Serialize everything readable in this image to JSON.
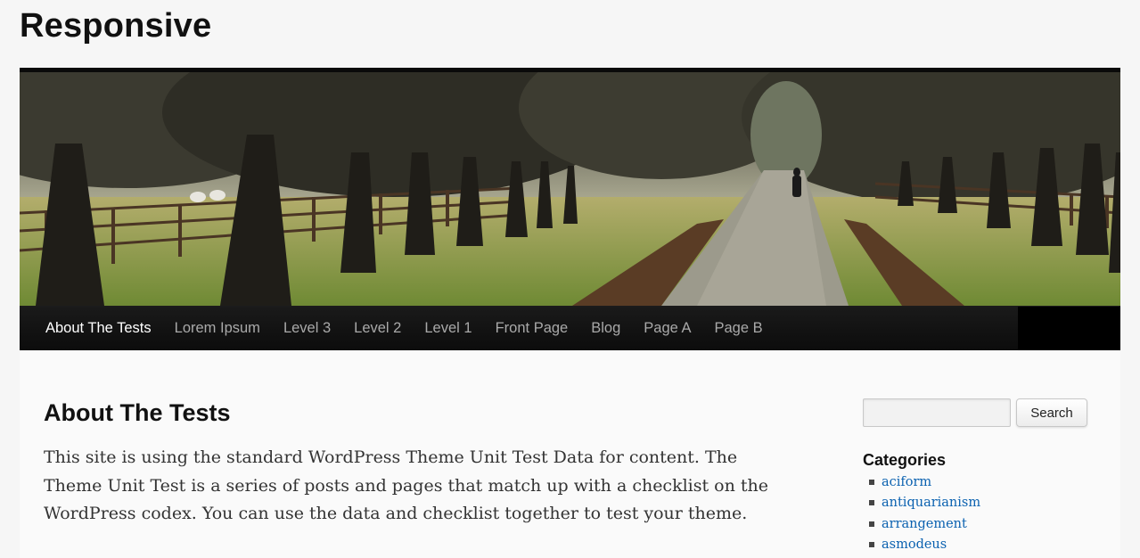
{
  "site": {
    "title": "Responsive"
  },
  "nav": {
    "items": [
      {
        "label": "About The Tests",
        "active": true
      },
      {
        "label": "Lorem Ipsum"
      },
      {
        "label": "Level 3"
      },
      {
        "label": "Level 2"
      },
      {
        "label": "Level 1"
      },
      {
        "label": "Front Page"
      },
      {
        "label": "Blog"
      },
      {
        "label": "Page A"
      },
      {
        "label": "Page B"
      }
    ]
  },
  "page": {
    "title": "About The Tests",
    "body": "This site is using the standard WordPress Theme Unit Test Data for content. The Theme Unit Test is a series of posts and pages that match up with a checklist on the WordPress codex. You can use the data and checklist together to test your theme."
  },
  "sidebar": {
    "search": {
      "value": "",
      "button_label": "Search"
    },
    "categories": {
      "title": "Categories",
      "items": [
        "aciform",
        "antiquarianism",
        "arrangement",
        "asmodeus"
      ]
    }
  },
  "colors": {
    "link": "#0a61b0",
    "nav_bg": "#000000",
    "nav_active": "#ffffff",
    "nav_text": "#a9a9a9"
  }
}
